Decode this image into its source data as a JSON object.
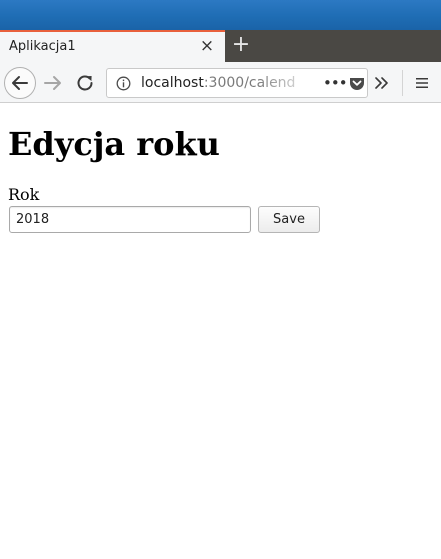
{
  "browser": {
    "tab_title": "Aplikacja1",
    "tab_close_glyph": "×",
    "new_tab_glyph": "+",
    "url_host": "localhost",
    "url_rest": ":3000/calend",
    "page_actions_glyph": "•••",
    "icons": [
      "back-arrow-icon",
      "forward-arrow-icon",
      "reload-icon",
      "info-icon",
      "pocket-icon",
      "overflow-chevron-icon",
      "hamburger-menu-icon"
    ],
    "colors": {
      "titlebar": "#1f6db4",
      "tabstrip": "#4a4844",
      "active_tab_accent": "#e8603c",
      "toolbar": "#f5f6f7"
    }
  },
  "page": {
    "title": "Edycja roku",
    "form": {
      "year_label": "Rok",
      "year_value": "2018",
      "save_label": "Save"
    }
  }
}
